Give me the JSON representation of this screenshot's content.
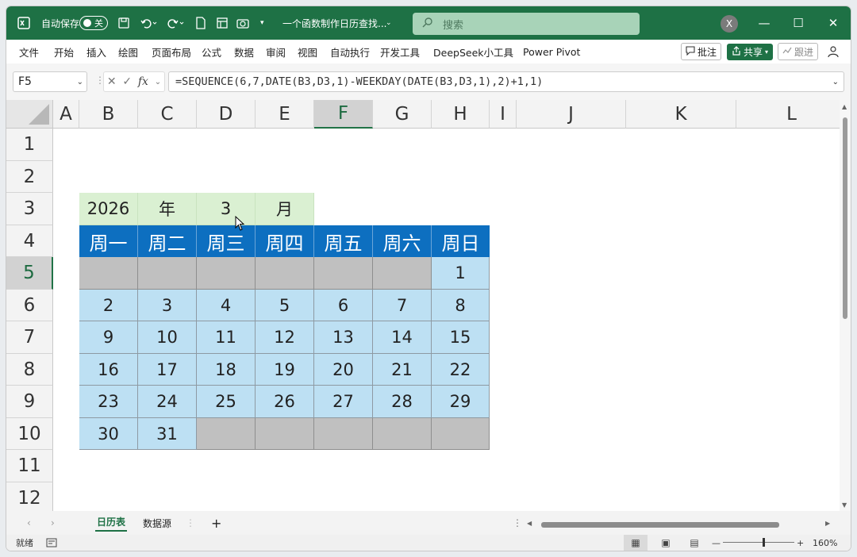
{
  "titlebar": {
    "autosave_label": "自动保存",
    "autosave_state": "关",
    "doc_title": "一个函数制作日历查找...",
    "search_placeholder": "搜索",
    "avatar_initial": "X",
    "minimize": "—",
    "maximize": "☐",
    "close": "✕"
  },
  "ribbon": {
    "tabs": [
      "文件",
      "开始",
      "插入",
      "绘图",
      "页面布局",
      "公式",
      "数据",
      "审阅",
      "视图",
      "自动执行",
      "开发工具",
      "DeepSeek小工具",
      "Power Pivot"
    ],
    "comment_label": "批注",
    "share_label": "共享",
    "catchup_label": "跟进"
  },
  "formula_bar": {
    "name_box": "F5",
    "formula": "=SEQUENCE(6,7,DATE(B3,D3,1)-WEEKDAY(DATE(B3,D3,1),2)+1,1)"
  },
  "columns": [
    "A",
    "B",
    "C",
    "D",
    "E",
    "F",
    "G",
    "H",
    "I",
    "J",
    "K",
    "L"
  ],
  "selected_column": "F",
  "rows": [
    "1",
    "2",
    "3",
    "4",
    "5",
    "6",
    "7",
    "8",
    "9",
    "10",
    "11",
    "12"
  ],
  "selected_row": "5",
  "calendar": {
    "year": "2026",
    "year_label": "年",
    "month": "3",
    "month_label": "月",
    "weekdays": [
      "周一",
      "周二",
      "周三",
      "周四",
      "周五",
      "周六",
      "周日"
    ],
    "weeks": [
      [
        "",
        "",
        "",
        "",
        "",
        "",
        "1"
      ],
      [
        "2",
        "3",
        "4",
        "5",
        "6",
        "7",
        "8"
      ],
      [
        "9",
        "10",
        "11",
        "12",
        "13",
        "14",
        "15"
      ],
      [
        "16",
        "17",
        "18",
        "19",
        "20",
        "21",
        "22"
      ],
      [
        "23",
        "24",
        "25",
        "26",
        "27",
        "28",
        "29"
      ],
      [
        "30",
        "31",
        "",
        "",
        "",
        "",
        ""
      ]
    ]
  },
  "sheets": {
    "tabs": [
      "日历表",
      "数据源"
    ],
    "active": "日历表",
    "add_label": "+"
  },
  "status": {
    "ready": "就绪",
    "zoom_minus": "—",
    "zoom_plus": "+",
    "zoom": "160%"
  },
  "colors": {
    "excel_green": "#1e7145",
    "header_blue": "#0d6fc0",
    "cell_blue": "#bde0f3",
    "cell_green": "#daf0d2",
    "cell_gray": "#c0c0c0"
  }
}
